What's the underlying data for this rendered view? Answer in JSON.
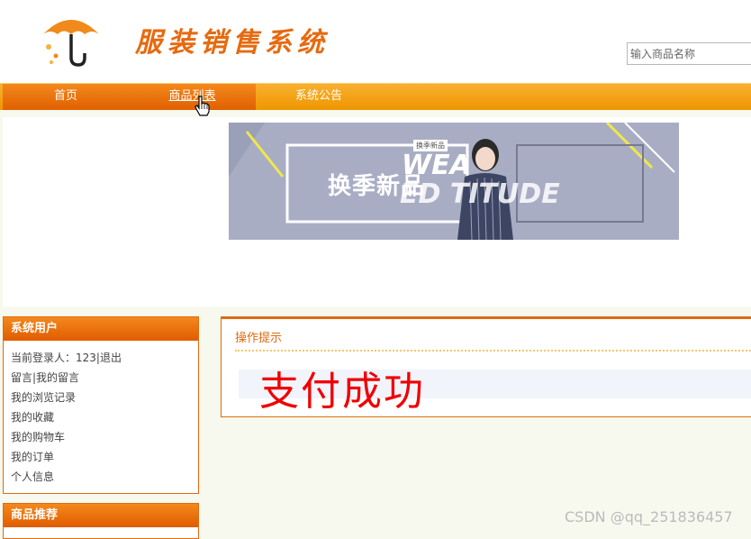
{
  "header": {
    "site_title": "服装销售系统",
    "search_placeholder": "输入商品名称"
  },
  "nav": {
    "home": "首页",
    "products": "商品列表",
    "notices": "系统公告"
  },
  "banner": {
    "badge": "换季新品",
    "headline": "换季新品",
    "text_a": "WEA",
    "text_b": "ED   TITUDE"
  },
  "sidebar_user": {
    "title": "系统用户",
    "items": [
      "当前登录人：123|退出",
      "留言|我的留言",
      "我的浏览记录",
      "我的收藏",
      "我的购物车",
      "我的订单",
      "个人信息"
    ]
  },
  "sidebar_recommend": {
    "title": "商品推荐"
  },
  "content": {
    "tip_title": "操作提示",
    "message": "支付成功"
  },
  "watermark": "CSDN @qq_251836457",
  "colors": {
    "brand_orange": "#e66a10",
    "nav_orange": "#f29d00",
    "success_red": "#f00000"
  }
}
